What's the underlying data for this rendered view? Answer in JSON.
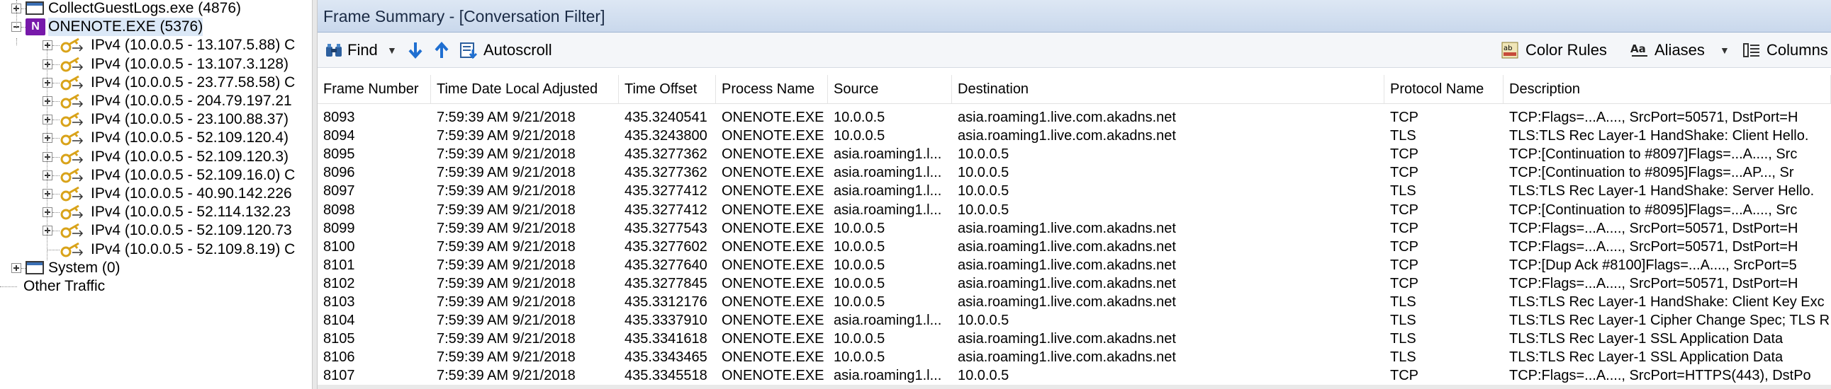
{
  "tree": {
    "items": [
      {
        "label": "CollectGuestLogs.exe (4876)",
        "type": "process"
      },
      {
        "label": "ONENOTE.EXE (5376)",
        "type": "onenote",
        "selected": true
      },
      {
        "label": "IPv4 (10.0.0.5 - 13.107.5.88) C",
        "type": "conv"
      },
      {
        "label": "IPv4 (10.0.0.5 - 13.107.3.128)",
        "type": "conv"
      },
      {
        "label": "IPv4 (10.0.0.5 - 23.77.58.58) C",
        "type": "conv"
      },
      {
        "label": "IPv4 (10.0.0.5 - 204.79.197.21",
        "type": "conv"
      },
      {
        "label": "IPv4 (10.0.0.5 - 23.100.88.37)",
        "type": "conv"
      },
      {
        "label": "IPv4 (10.0.0.5 - 52.109.120.4)",
        "type": "conv"
      },
      {
        "label": "IPv4 (10.0.0.5 - 52.109.120.3)",
        "type": "conv"
      },
      {
        "label": "IPv4 (10.0.0.5 - 52.109.16.0) C",
        "type": "conv"
      },
      {
        "label": "IPv4 (10.0.0.5 - 40.90.142.226",
        "type": "conv"
      },
      {
        "label": "IPv4 (10.0.0.5 - 52.114.132.23",
        "type": "conv"
      },
      {
        "label": "IPv4 (10.0.0.5 - 52.109.120.73",
        "type": "conv"
      },
      {
        "label": "IPv4 (10.0.0.5 - 52.109.8.19) C",
        "type": "conv-leaf"
      },
      {
        "label": "System (0)",
        "type": "process"
      },
      {
        "label": "Other Traffic",
        "type": "other"
      }
    ]
  },
  "panel": {
    "title": "Frame Summary - [Conversation Filter]"
  },
  "toolbar": {
    "find_label": "Find",
    "autoscroll_label": "Autoscroll",
    "color_rules_label": "Color Rules",
    "aliases_label": "Aliases",
    "columns_label": "Columns"
  },
  "columns": {
    "frame": "Frame Number",
    "time": "Time Date Local Adjusted",
    "offset": "Time Offset",
    "process": "Process Name",
    "source": "Source",
    "destination": "Destination",
    "protocol": "Protocol Name",
    "description": "Description"
  },
  "rows": [
    {
      "frame": "8093",
      "time": "7:59:39 AM 9/21/2018",
      "offset": "435.3240541",
      "process": "ONENOTE.EXE",
      "source": "10.0.0.5",
      "destination": "asia.roaming1.live.com.akadns.net",
      "protocol": "TCP",
      "description": "TCP:Flags=...A...., SrcPort=50571, DstPort=H"
    },
    {
      "frame": "8094",
      "time": "7:59:39 AM 9/21/2018",
      "offset": "435.3243800",
      "process": "ONENOTE.EXE",
      "source": "10.0.0.5",
      "destination": "asia.roaming1.live.com.akadns.net",
      "protocol": "TLS",
      "description": "TLS:TLS Rec Layer-1 HandShake: Client Hello."
    },
    {
      "frame": "8095",
      "time": "7:59:39 AM 9/21/2018",
      "offset": "435.3277362",
      "process": "ONENOTE.EXE",
      "source": "asia.roaming1.l...",
      "destination": "10.0.0.5",
      "protocol": "TCP",
      "description": "TCP:[Continuation to #8097]Flags=...A...., Src"
    },
    {
      "frame": "8096",
      "time": "7:59:39 AM 9/21/2018",
      "offset": "435.3277362",
      "process": "ONENOTE.EXE",
      "source": "asia.roaming1.l...",
      "destination": "10.0.0.5",
      "protocol": "TCP",
      "description": "TCP:[Continuation to #8095]Flags=...AP..., Sr"
    },
    {
      "frame": "8097",
      "time": "7:59:39 AM 9/21/2018",
      "offset": "435.3277412",
      "process": "ONENOTE.EXE",
      "source": "asia.roaming1.l...",
      "destination": "10.0.0.5",
      "protocol": "TLS",
      "description": "TLS:TLS Rec Layer-1 HandShake: Server Hello."
    },
    {
      "frame": "8098",
      "time": "7:59:39 AM 9/21/2018",
      "offset": "435.3277412",
      "process": "ONENOTE.EXE",
      "source": "asia.roaming1.l...",
      "destination": "10.0.0.5",
      "protocol": "TCP",
      "description": "TCP:[Continuation to #8095]Flags=...A...., Src"
    },
    {
      "frame": "8099",
      "time": "7:59:39 AM 9/21/2018",
      "offset": "435.3277543",
      "process": "ONENOTE.EXE",
      "source": "10.0.0.5",
      "destination": "asia.roaming1.live.com.akadns.net",
      "protocol": "TCP",
      "description": "TCP:Flags=...A...., SrcPort=50571, DstPort=H"
    },
    {
      "frame": "8100",
      "time": "7:59:39 AM 9/21/2018",
      "offset": "435.3277602",
      "process": "ONENOTE.EXE",
      "source": "10.0.0.5",
      "destination": "asia.roaming1.live.com.akadns.net",
      "protocol": "TCP",
      "description": "TCP:Flags=...A...., SrcPort=50571, DstPort=H"
    },
    {
      "frame": "8101",
      "time": "7:59:39 AM 9/21/2018",
      "offset": "435.3277640",
      "process": "ONENOTE.EXE",
      "source": "10.0.0.5",
      "destination": "asia.roaming1.live.com.akadns.net",
      "protocol": "TCP",
      "description": "TCP:[Dup Ack #8100]Flags=...A...., SrcPort=5"
    },
    {
      "frame": "8102",
      "time": "7:59:39 AM 9/21/2018",
      "offset": "435.3277845",
      "process": "ONENOTE.EXE",
      "source": "10.0.0.5",
      "destination": "asia.roaming1.live.com.akadns.net",
      "protocol": "TCP",
      "description": "TCP:Flags=...A...., SrcPort=50571, DstPort=H"
    },
    {
      "frame": "8103",
      "time": "7:59:39 AM 9/21/2018",
      "offset": "435.3312176",
      "process": "ONENOTE.EXE",
      "source": "10.0.0.5",
      "destination": "asia.roaming1.live.com.akadns.net",
      "protocol": "TLS",
      "description": "TLS:TLS Rec Layer-1 HandShake: Client Key Exc"
    },
    {
      "frame": "8104",
      "time": "7:59:39 AM 9/21/2018",
      "offset": "435.3337910",
      "process": "ONENOTE.EXE",
      "source": "asia.roaming1.l...",
      "destination": "10.0.0.5",
      "protocol": "TLS",
      "description": "TLS:TLS Rec Layer-1 Cipher Change Spec; TLS R"
    },
    {
      "frame": "8105",
      "time": "7:59:39 AM 9/21/2018",
      "offset": "435.3341618",
      "process": "ONENOTE.EXE",
      "source": "10.0.0.5",
      "destination": "asia.roaming1.live.com.akadns.net",
      "protocol": "TLS",
      "description": "TLS:TLS Rec Layer-1 SSL Application Data"
    },
    {
      "frame": "8106",
      "time": "7:59:39 AM 9/21/2018",
      "offset": "435.3343465",
      "process": "ONENOTE.EXE",
      "source": "10.0.0.5",
      "destination": "asia.roaming1.live.com.akadns.net",
      "protocol": "TLS",
      "description": "TLS:TLS Rec Layer-1 SSL Application Data"
    },
    {
      "frame": "8107",
      "time": "7:59:39 AM 9/21/2018",
      "offset": "435.3345518",
      "process": "ONENOTE.EXE",
      "source": "asia.roaming1.l...",
      "destination": "10.0.0.5",
      "protocol": "TCP",
      "description": "TCP:Flags=...A...., SrcPort=HTTPS(443), DstPo"
    }
  ],
  "icons": {
    "find": "binoculars-icon",
    "next": "arrow-down-icon",
    "prev": "arrow-up-icon",
    "autoscroll": "autoscroll-icon",
    "color_rules": "color-rules-icon",
    "aliases": "aliases-icon",
    "columns": "columns-icon"
  },
  "colors": {
    "title_bar": "#c9d8ec",
    "onenote": "#7719aa",
    "arrow": "#1f6fd1",
    "key": "#d9a31a"
  }
}
